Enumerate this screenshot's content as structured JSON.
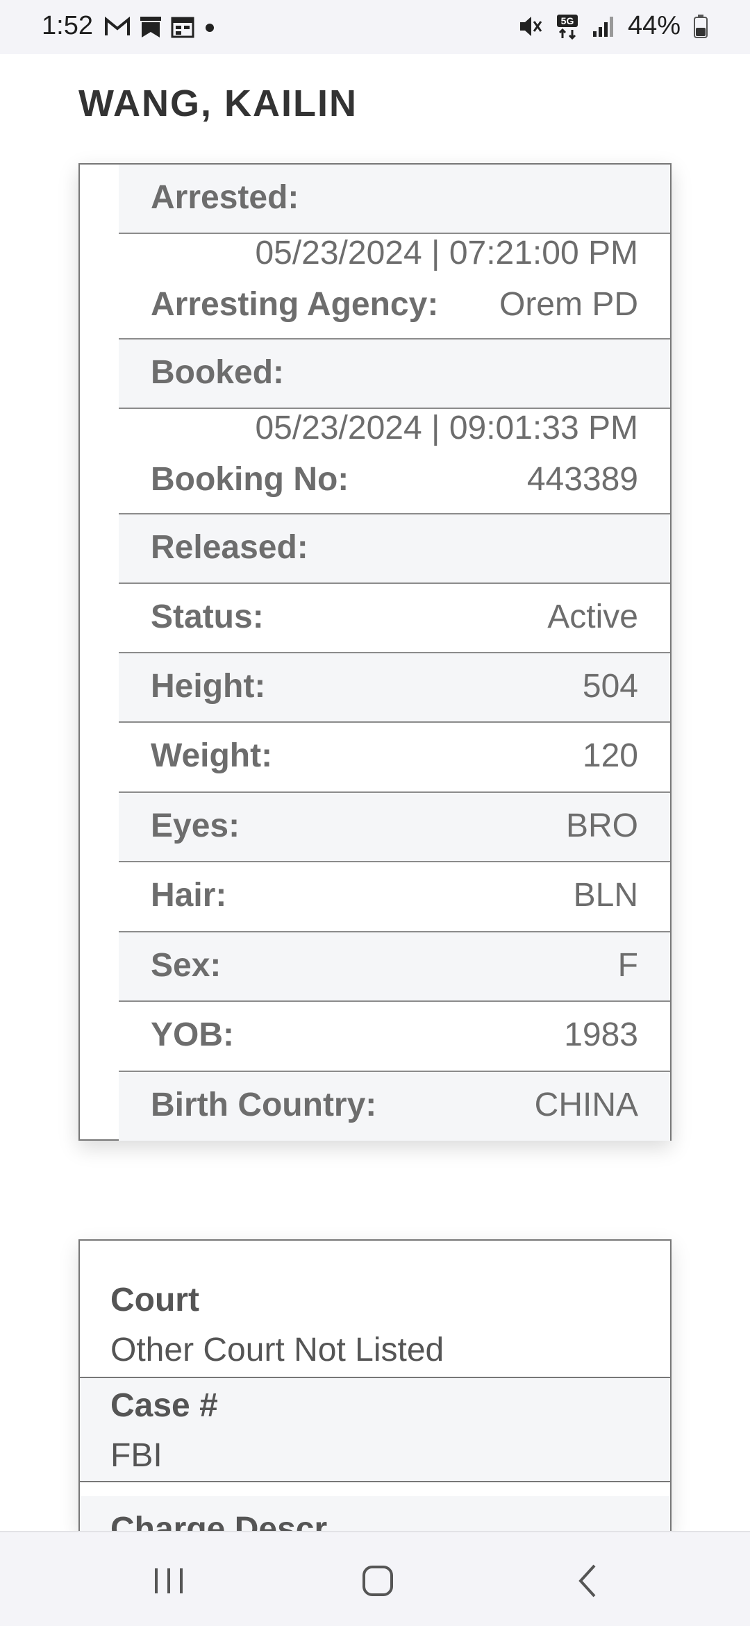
{
  "status_bar": {
    "time": "1:52",
    "left_icons": [
      "gmail-icon",
      "bookmark-notification-icon",
      "calendar-icon",
      "dot-icon"
    ],
    "right_icons": [
      "mute-icon",
      "5g-icon",
      "signal-icon"
    ],
    "battery": "44%"
  },
  "page": {
    "name": "WANG, KAILIN"
  },
  "details": {
    "arrested_label": "Arrested:",
    "arrested_value": "05/23/2024 | 07:21:00 PM",
    "agency_label": "Arresting Agency:",
    "agency_value": "Orem PD",
    "booked_label": "Booked:",
    "booked_value": "05/23/2024 | 09:01:33 PM",
    "booking_no_label": "Booking No:",
    "booking_no_value": "443389",
    "released_label": "Released:",
    "status_label": "Status:",
    "status_value": "Active",
    "height_label": "Height:",
    "height_value": "504",
    "weight_label": "Weight:",
    "weight_value": "120",
    "eyes_label": "Eyes:",
    "eyes_value": "BRO",
    "hair_label": "Hair:",
    "hair_value": "BLN",
    "sex_label": "Sex:",
    "sex_value": "F",
    "yob_label": "YOB:",
    "yob_value": "1983",
    "birth_country_label": "Birth Country:",
    "birth_country_value": "CHINA"
  },
  "court": {
    "court_label": "Court",
    "court_value": "Other Court Not Listed",
    "case_label": "Case #",
    "case_value": "FBI",
    "charge_label": "Charge Descr"
  },
  "nav": {
    "icons": [
      "recent-apps-icon",
      "home-icon",
      "back-icon"
    ]
  }
}
